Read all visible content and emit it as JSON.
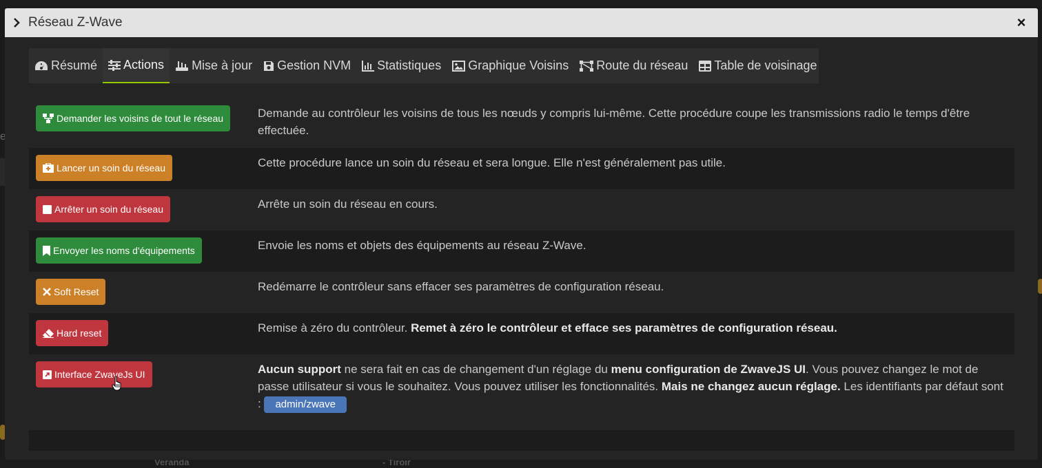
{
  "background": {
    "label_left": "e",
    "label_veranda": "Veranda",
    "label_tiroir": "- Tiroir"
  },
  "modal": {
    "title": "Réseau Z-Wave",
    "close_label": "×"
  },
  "tabs": [
    {
      "label": "Résumé",
      "icon": "dashboard-icon",
      "active": false
    },
    {
      "label": "Actions",
      "icon": "sliders-icon",
      "active": true
    },
    {
      "label": "Mise à jour",
      "icon": "router-icon",
      "active": false
    },
    {
      "label": "Gestion NVM",
      "icon": "save-icon",
      "active": false
    },
    {
      "label": "Statistiques",
      "icon": "bar-chart-icon",
      "active": false
    },
    {
      "label": "Graphique Voisins",
      "icon": "image-icon",
      "active": false
    },
    {
      "label": "Route du réseau",
      "icon": "network-icon",
      "active": false
    },
    {
      "label": "Table de voisinage",
      "icon": "table-icon",
      "active": false
    }
  ],
  "actions": [
    {
      "button_label": "Demander les voisins de tout le réseau",
      "icon": "sitemap-icon",
      "color": "#2e8b3b",
      "description": "Demande au contrôleur les voisins de tous les nœuds y compris lui-même. Cette procédure coupe les transmissions radio le temps d'être effectuée."
    },
    {
      "button_label": "Lancer un soin du réseau",
      "icon": "medkit-icon",
      "color": "#cc8128",
      "description": "Cette procédure lance un soin du réseau et sera longue. Elle n'est généralement pas utile."
    },
    {
      "button_label": "Arrêter un soin du réseau",
      "icon": "stop-icon",
      "color": "#c0363f",
      "description": "Arrête un soin du réseau en cours."
    },
    {
      "button_label": "Envoyer les noms d'équipements",
      "icon": "bookmark-icon",
      "color": "#2e8b3b",
      "description": "Envoie les noms et objets des équipements au réseau Z-Wave."
    },
    {
      "button_label": "Soft Reset",
      "icon": "times-icon",
      "color": "#cc8128",
      "description": "Redémarre le contrôleur sans effacer ses paramètres de configuration réseau."
    },
    {
      "button_label": "Hard reset",
      "icon": "eraser-icon",
      "color": "#c0363f",
      "description_plain": "Remise à zéro du contrôleur. ",
      "description_bold": "Remet à zéro le contrôleur et efface ses paramètres de configuration réseau."
    },
    {
      "button_label": "Interface ZwaveJs UI",
      "icon": "external-link-icon",
      "color": "#c0363f",
      "desc_bold_1": "Aucun support",
      "desc_text_1": " ne sera fait en cas de changement d'un réglage du ",
      "desc_bold_2": "menu configuration de ZwaveJS UI",
      "desc_text_2": ". Vous pouvez changez le mot de passe utilisateur si vous le souhaitez. Vous pouvez utiliser les fonctionnalités. ",
      "desc_bold_3": "Mais ne changez aucun réglage.",
      "desc_text_3": " Les identifiants par défaut sont : ",
      "credentials_badge": "admin/zwave"
    }
  ]
}
